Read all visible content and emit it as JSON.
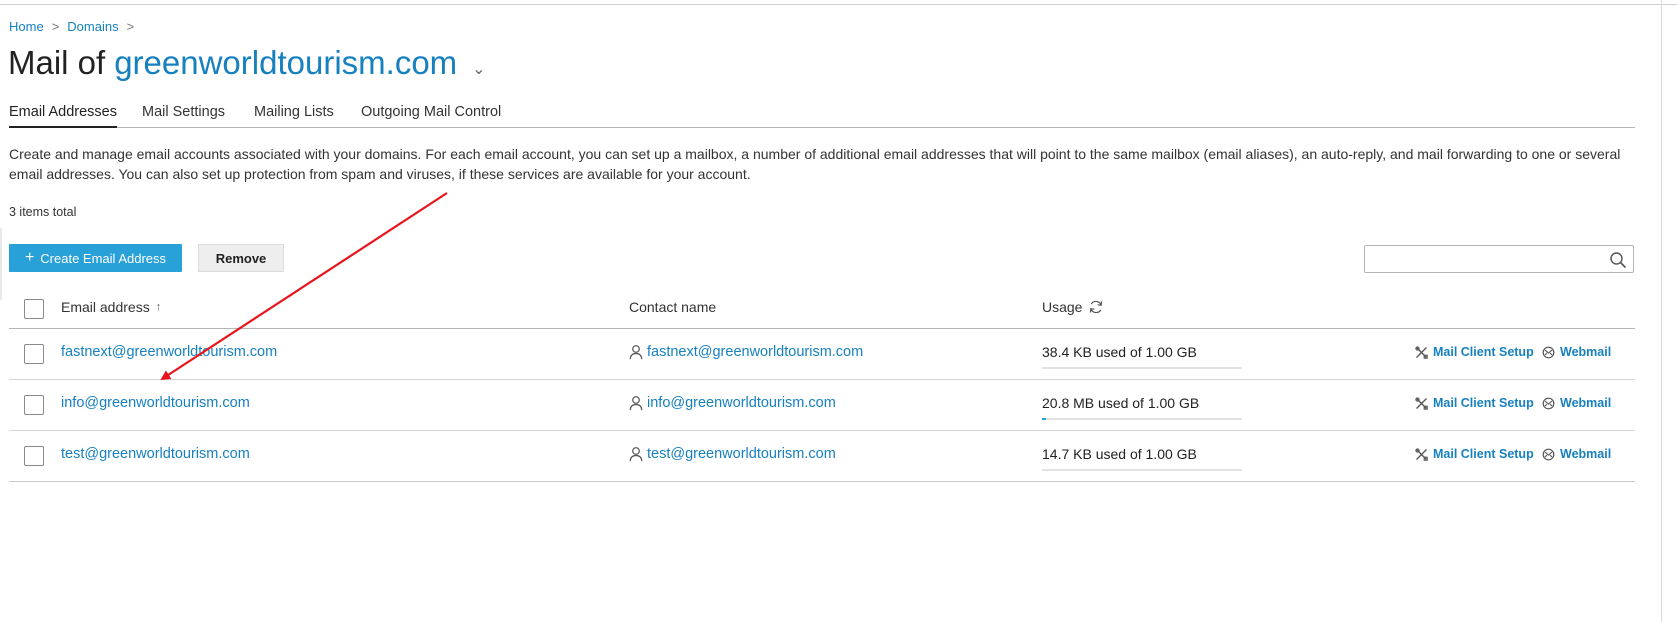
{
  "breadcrumb": {
    "home": "Home",
    "domains": "Domains",
    "sep": ">"
  },
  "title": {
    "prefix": "Mail of",
    "domain": "greenworldtourism.com",
    "chevron": "⌄"
  },
  "tabs": [
    {
      "label": "Email Addresses",
      "active": true
    },
    {
      "label": "Mail Settings",
      "active": false
    },
    {
      "label": "Mailing Lists",
      "active": false
    },
    {
      "label": "Outgoing Mail Control",
      "active": false
    }
  ],
  "description": "Create and manage email accounts associated with your domains. For each email account, you can set up a mailbox, a number of additional email addresses that will point to the same mailbox (email aliases), an auto-reply, and mail forwarding to one or several email addresses. You can also set up protection from spam and viruses, if these services are available for your account.",
  "count": "3 items total",
  "toolbar": {
    "create_label": "Create Email Address",
    "create_icon": "+",
    "remove_label": "Remove"
  },
  "search": {
    "placeholder": "",
    "icon": "search-icon"
  },
  "table": {
    "headers": {
      "email": "Email address",
      "sort": "↑",
      "contact": "Contact name",
      "usage": "Usage"
    },
    "rows": [
      {
        "email": "fastnext@greenworldtourism.com",
        "contact": "fastnext@greenworldtourism.com",
        "usage": "38.4 KB used of 1.00 GB",
        "usage_fraction": 0.0,
        "setup": "Mail Client Setup",
        "webmail": "Webmail"
      },
      {
        "email": "info@greenworldtourism.com",
        "contact": "info@greenworldtourism.com",
        "usage": "20.8 MB used of 1.00 GB",
        "usage_fraction": 0.02,
        "setup": "Mail Client Setup",
        "webmail": "Webmail"
      },
      {
        "email": "test@greenworldtourism.com",
        "contact": "test@greenworldtourism.com",
        "usage": "14.7 KB used of 1.00 GB",
        "usage_fraction": 0.0,
        "setup": "Mail Client Setup",
        "webmail": "Webmail"
      }
    ]
  },
  "colors": {
    "link": "#1780bf",
    "primary_button": "#28a0d8",
    "annotation_arrow": "#e8141c"
  }
}
